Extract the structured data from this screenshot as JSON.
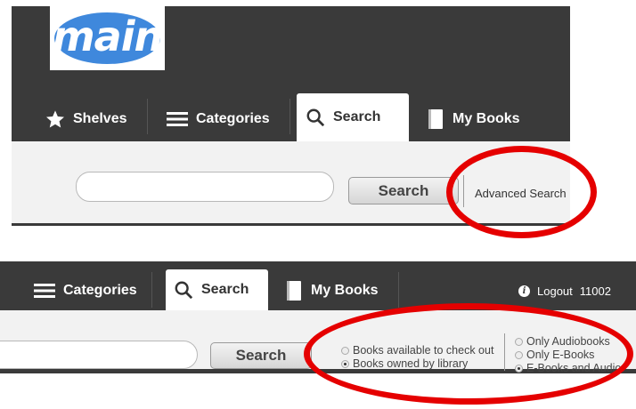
{
  "logo": {
    "text": "main"
  },
  "top_nav": {
    "tabs": [
      {
        "label": "Shelves",
        "icon": "star-icon"
      },
      {
        "label": "Categories",
        "icon": "menu-icon"
      },
      {
        "label": "Search",
        "icon": "search-icon",
        "active": true
      },
      {
        "label": "My Books",
        "icon": "book-icon"
      }
    ]
  },
  "top_search": {
    "input_value": "",
    "button_label": "Search",
    "advanced_link": "Advanced Search"
  },
  "bottom_nav": {
    "tabs": [
      {
        "label": "Categories",
        "icon": "menu-icon"
      },
      {
        "label": "Search",
        "icon": "search-icon",
        "active": true
      },
      {
        "label": "My Books",
        "icon": "book-icon"
      }
    ],
    "logout_label": "Logout",
    "account_number": "11002"
  },
  "bottom_search": {
    "input_value": "",
    "button_label": "Search",
    "availability_options": [
      {
        "label": "Books available to check out",
        "selected": false
      },
      {
        "label": "Books owned by library",
        "selected": true
      }
    ],
    "format_options": [
      {
        "label": "Only Audiobooks",
        "selected": false
      },
      {
        "label": "Only E-Books",
        "selected": false
      },
      {
        "label": "E-Books and Audio",
        "selected": true
      }
    ]
  },
  "colors": {
    "header_bg": "#3a3a3a",
    "annotation": "#e50000",
    "logo_blue": "#3f88dc"
  }
}
